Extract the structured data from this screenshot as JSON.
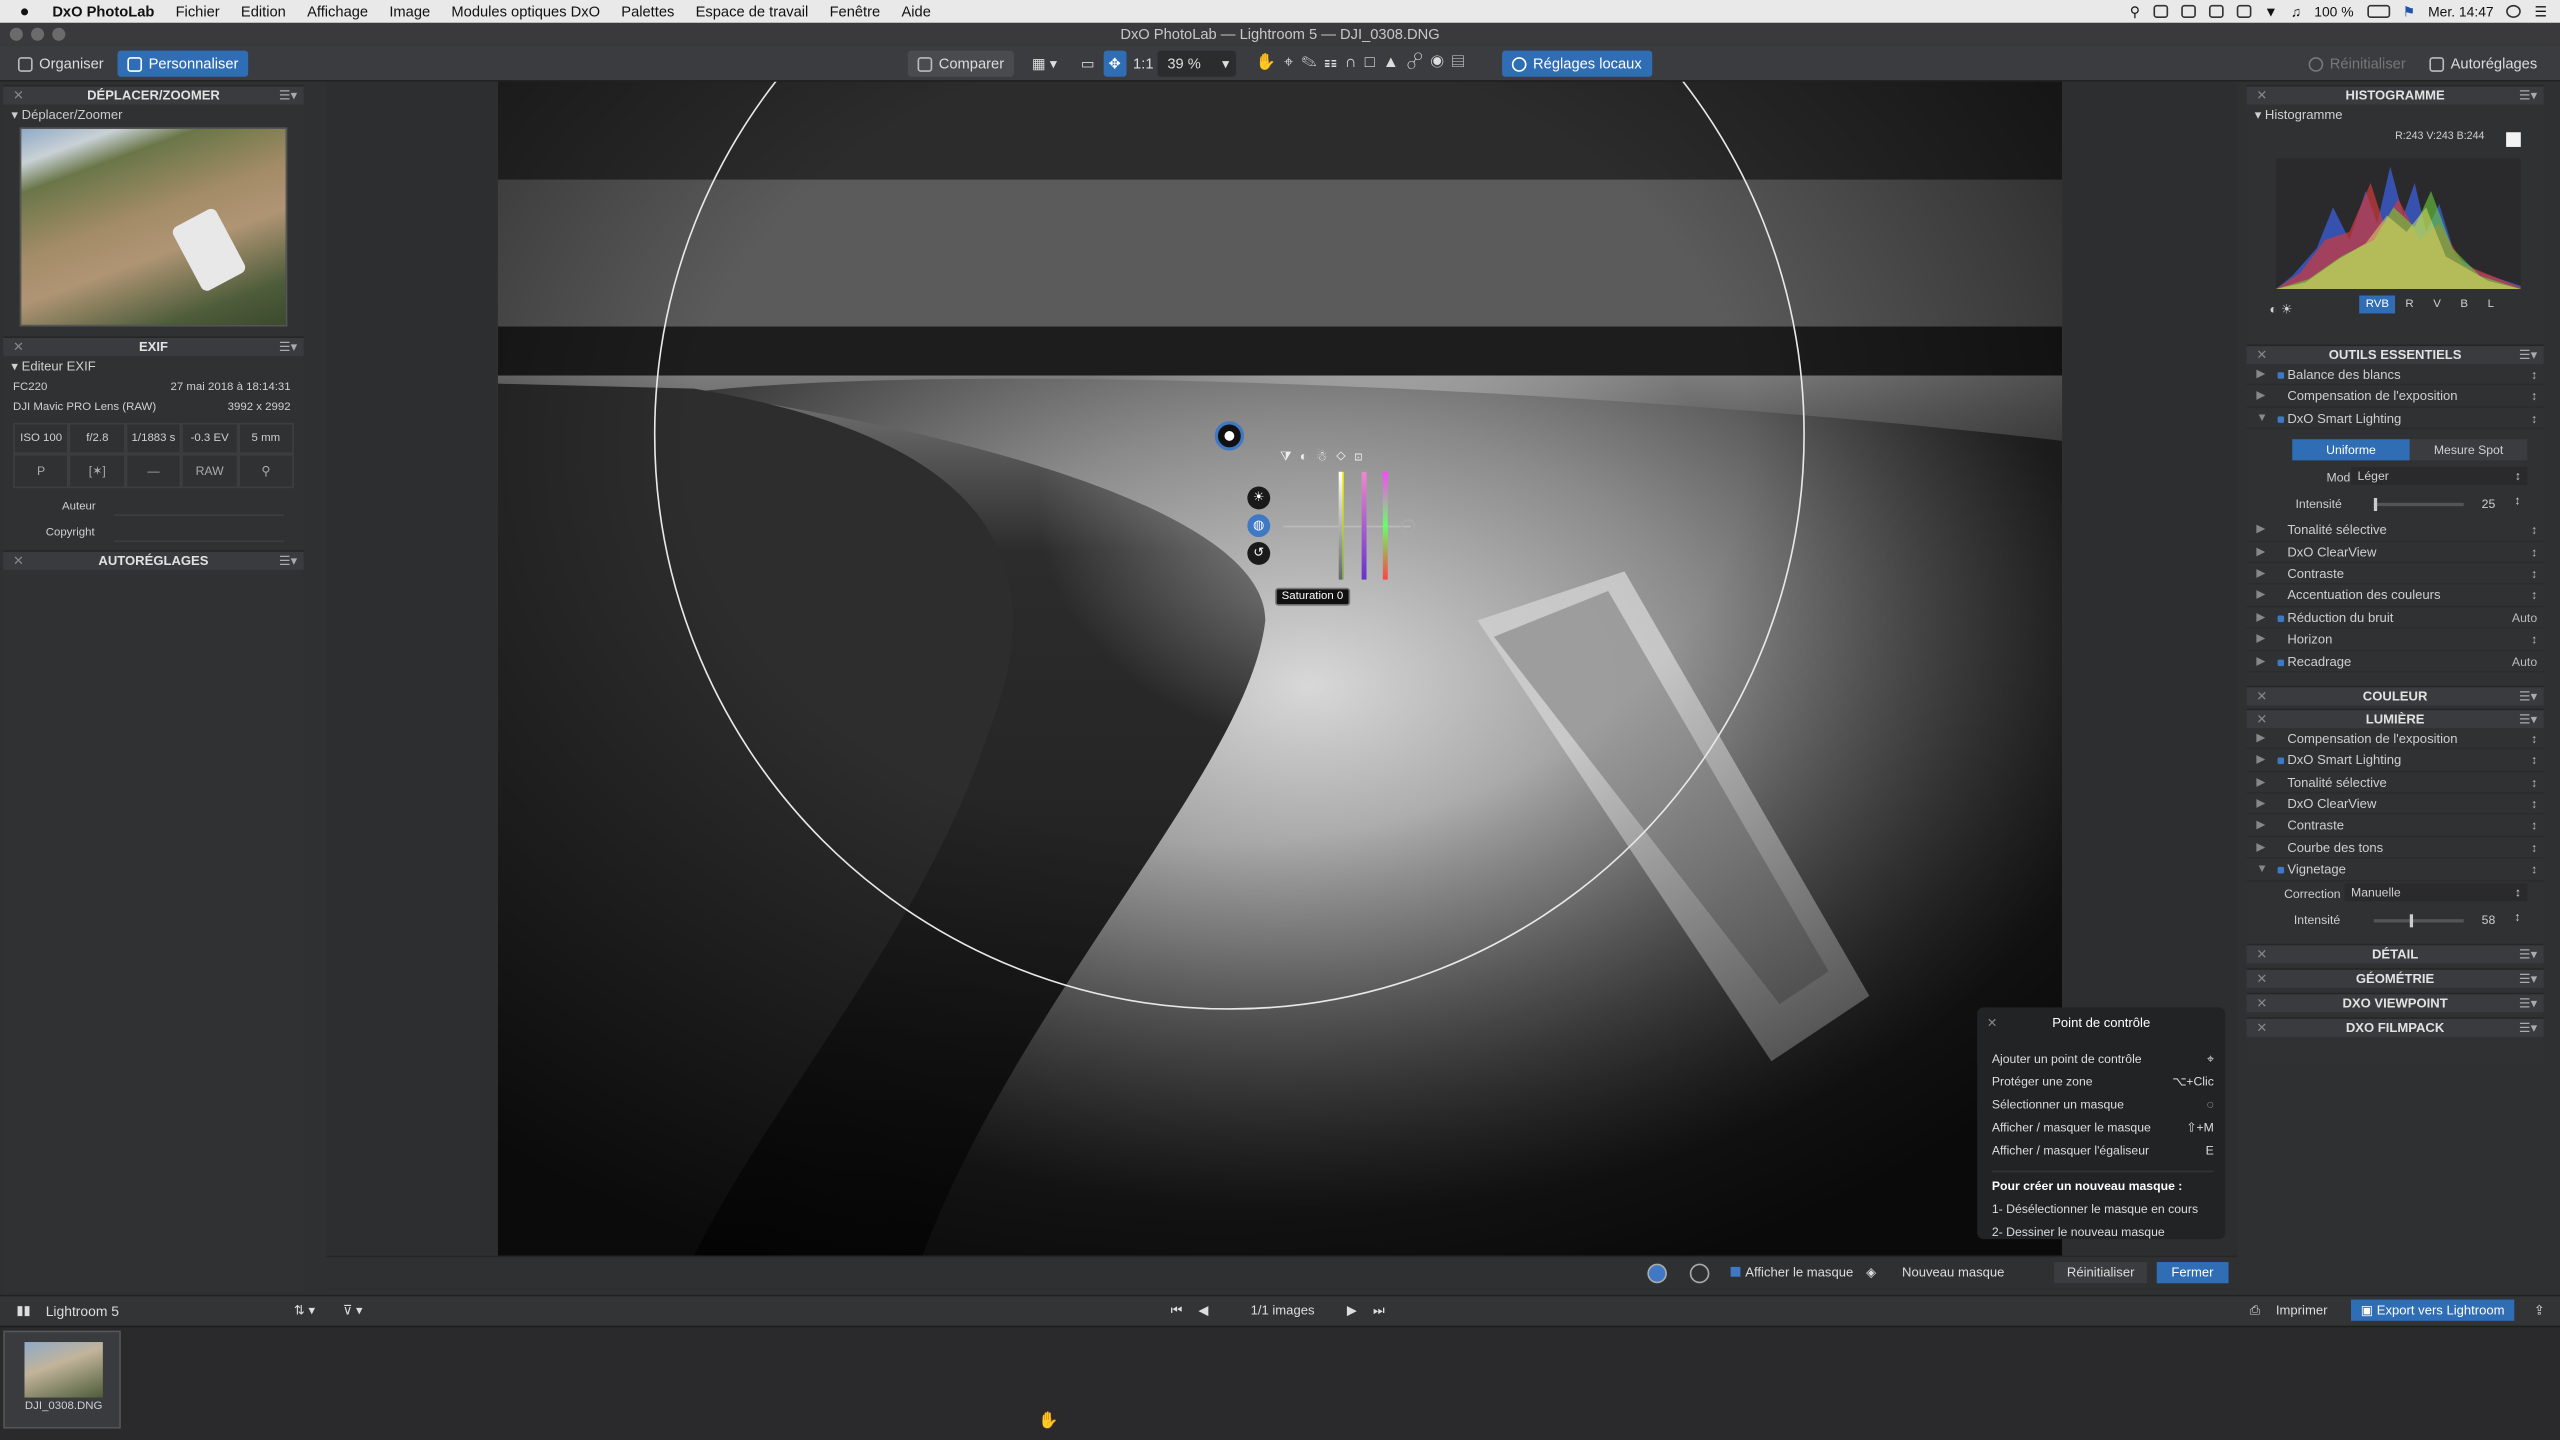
{
  "menubar": {
    "app": "DxO PhotoLab",
    "items": [
      "Fichier",
      "Edition",
      "Affichage",
      "Image",
      "Modules optiques DxO",
      "Palettes",
      "Espace de travail",
      "Fenêtre",
      "Aide"
    ],
    "battery": "100 %",
    "clock": "Mer. 14:47"
  },
  "window": {
    "title": "DxO PhotoLab — Lightroom 5 — DJI_0308.DNG"
  },
  "toolbar": {
    "organiser": "Organiser",
    "personnaliser": "Personnaliser",
    "comparer": "Comparer",
    "zoom_fit": "1:1",
    "zoom": "39 %",
    "local": "Réglages locaux",
    "reset": "Réinitialiser",
    "auto": "Autoréglages"
  },
  "left": {
    "move_zoom": {
      "title": "DÉPLACER/ZOOMER",
      "label": "Déplacer/Zoomer"
    },
    "exif": {
      "title": "EXIF",
      "editor": "Editeur EXIF",
      "camera": "FC220",
      "date": "27 mai 2018 à 18:14:31",
      "lens": "DJI Mavic PRO Lens (RAW)",
      "dims": "3992 x 2992",
      "iso": "ISO 100",
      "aperture": "f/2.8",
      "shutter": "1/1883 s",
      "ev": "-0.3 EV",
      "focal": "5 mm",
      "mode": "P",
      "flash": "—",
      "format": "RAW",
      "author_label": "Auteur",
      "copyright_label": "Copyright"
    },
    "autoreglages": {
      "title": "AUTORÉGLAGES"
    }
  },
  "right": {
    "histogram": {
      "title": "HISTOGRAMME",
      "label": "Histogramme",
      "values": "R:243 V:243 B:244",
      "channels": [
        "RVB",
        "R",
        "V",
        "B",
        "L"
      ]
    },
    "essentials": {
      "title": "OUTILS ESSENTIELS",
      "items": [
        {
          "label": "Balance des blancs",
          "on": true
        },
        {
          "label": "Compensation de l'exposition",
          "on": false
        },
        {
          "label": "DxO Smart Lighting",
          "on": true,
          "open": true
        }
      ],
      "smart": {
        "uniform": "Uniforme",
        "spot": "Mesure Spot",
        "mode_label": "Mode",
        "mode_value": "Léger",
        "intensity_label": "Intensité",
        "intensity": "25"
      },
      "items2": [
        {
          "label": "Tonalité sélective",
          "end": ""
        },
        {
          "label": "DxO ClearView",
          "end": ""
        },
        {
          "label": "Contraste",
          "end": ""
        },
        {
          "label": "Accentuation des couleurs",
          "end": ""
        },
        {
          "label": "Réduction du bruit",
          "end": "Auto"
        },
        {
          "label": "Horizon",
          "end": ""
        },
        {
          "label": "Recadrage",
          "end": "Auto"
        }
      ]
    },
    "couleur": {
      "title": "COULEUR"
    },
    "lumiere": {
      "title": "LUMIÈRE",
      "items": [
        "Compensation de l'exposition",
        "DxO Smart Lighting",
        "Tonalité sélective",
        "DxO ClearView",
        "Contraste",
        "Courbe des tons",
        "Vignetage"
      ],
      "vign": {
        "correction_label": "Correction",
        "correction_value": "Manuelle",
        "intensity_label": "Intensité",
        "intensity": "58"
      }
    },
    "detail": {
      "title": "DÉTAIL"
    },
    "geometrie": {
      "title": "GÉOMÉTRIE"
    },
    "viewpoint": {
      "title": "DXO VIEWPOINT"
    },
    "filmpack": {
      "title": "DXO FILMPACK"
    }
  },
  "control_point": {
    "title": "Point de contrôle",
    "rows": [
      {
        "label": "Ajouter un point de contrôle",
        "key": "⌖"
      },
      {
        "label": "Protéger une zone",
        "key": "⌥+Clic"
      },
      {
        "label": "Sélectionner un masque",
        "key": "◌"
      },
      {
        "label": "Afficher / masquer le masque",
        "key": "⇧+M"
      },
      {
        "label": "Afficher / masquer l'égaliseur",
        "key": "E"
      }
    ],
    "howto_title": "Pour créer un nouveau masque :",
    "step1": "1- Désélectionner le masque en cours",
    "step2": "2- Dessiner le nouveau masque"
  },
  "saturation_label": "Saturation 0",
  "bottom_bar": {
    "show_mask": "Afficher le masque",
    "new_mask": "Nouveau masque",
    "reset": "Réinitialiser",
    "close": "Fermer"
  },
  "filmbar": {
    "project": "Lightroom 5",
    "count": "1/1 images",
    "print": "Imprimer",
    "export": "Export vers Lightroom"
  },
  "thumb": {
    "name": "DJI_0308.DNG"
  }
}
